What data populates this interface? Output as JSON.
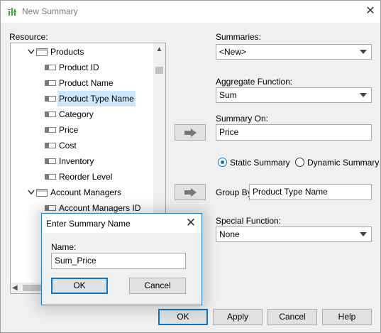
{
  "window": {
    "title": "New Summary",
    "icon": "bar-chart-icon",
    "close_glyph": "✕"
  },
  "resource": {
    "label": "Resource:",
    "tree": [
      {
        "label": "Products",
        "kind": "table",
        "expanded": true
      },
      {
        "label": "Product ID",
        "kind": "field"
      },
      {
        "label": "Product Name",
        "kind": "field"
      },
      {
        "label": "Product Type Name",
        "kind": "field",
        "selected": true
      },
      {
        "label": "Category",
        "kind": "field"
      },
      {
        "label": "Price",
        "kind": "field"
      },
      {
        "label": "Cost",
        "kind": "field"
      },
      {
        "label": "Inventory",
        "kind": "field"
      },
      {
        "label": "Reorder Level",
        "kind": "field"
      },
      {
        "label": "Account Managers",
        "kind": "table",
        "expanded": true
      },
      {
        "label": "Account Managers ID",
        "kind": "field"
      }
    ]
  },
  "summaries": {
    "label": "Summaries:",
    "value": "<New>"
  },
  "aggregate": {
    "label": "Aggregate Function:",
    "value": "Sum"
  },
  "summary_on": {
    "label": "Summary On:",
    "value": "Price"
  },
  "mode": {
    "static_label": "Static Summary",
    "dynamic_label": "Dynamic Summary",
    "selected": "static"
  },
  "group_by": {
    "label": "Group By",
    "value": "Product Type Name"
  },
  "special": {
    "label": "Special Function:",
    "value": "None"
  },
  "buttons": {
    "ok": "OK",
    "apply": "Apply",
    "cancel": "Cancel",
    "help": "Help"
  },
  "enter_name_dialog": {
    "title": "Enter Summary Name",
    "name_label": "Name:",
    "name_value": "Sum_Price",
    "ok": "OK",
    "cancel": "Cancel"
  },
  "colors": {
    "accent": "#0078d7",
    "selection": "#cce8ff",
    "icon_green": "#3aa935"
  }
}
